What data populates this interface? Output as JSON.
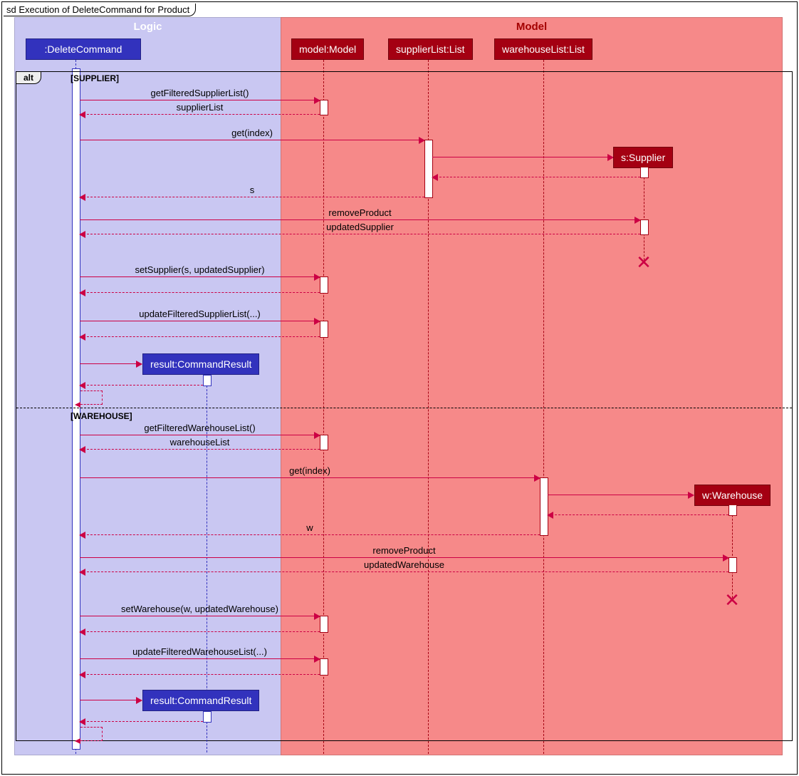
{
  "frame_title": "sd Execution of DeleteCommand for Product",
  "packages": {
    "logic": "Logic",
    "model": "Model"
  },
  "participants": {
    "delete_cmd": ":DeleteCommand",
    "model": "model:Model",
    "supplier_list": "supplierList:List",
    "warehouse_list": "warehouseList:List",
    "s_supplier": "s:Supplier",
    "result1": "result:CommandResult",
    "w_warehouse": "w:Warehouse",
    "result2": "result:CommandResult"
  },
  "alt": {
    "label": "alt",
    "guard_supplier": "[SUPPLIER]",
    "guard_warehouse": "[WAREHOUSE]"
  },
  "messages": {
    "m1": "getFilteredSupplierList()",
    "m2": "supplierList",
    "m3": "get(index)",
    "m4": "s",
    "m5": "removeProduct",
    "m6": "updatedSupplier",
    "m7": "setSupplier(s, updatedSupplier)",
    "m8": "updateFilteredSupplierList(...)",
    "m9": "getFilteredWarehouseList()",
    "m10": "warehouseList",
    "m11": "get(index)",
    "m12": "w",
    "m13": "removeProduct",
    "m14": "updatedWarehouse",
    "m15": "setWarehouse(w, updatedWarehouse)",
    "m16": "updateFilteredWarehouseList(...)"
  }
}
